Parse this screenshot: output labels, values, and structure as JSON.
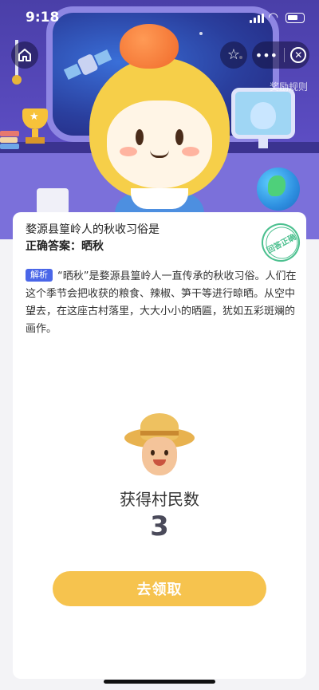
{
  "status_bar": {
    "time": "9:18"
  },
  "header": {
    "rules_link": "奖励规则"
  },
  "card": {
    "question": "婺源县篁岭人的秋收习俗是",
    "answer": "正确答案：晒秋",
    "stamp": "回答正确",
    "analysis_tag": "解析",
    "analysis_text": "“晒秋”是婺源县篁岭人一直传承的秋收习俗。人们在这个季节会把收获的粮食、辣椒、笋干等进行晾晒。从空中望去，在这座古村落里，大大小小的晒匾，犹如五彩斑斓的画作。",
    "reward_label": "获得村民数",
    "reward_count": "3",
    "claim_button": "去领取"
  },
  "icons": {
    "home": "home-icon",
    "favorite": "star-outline-icon",
    "more": "more-dots-icon",
    "close": "close-circle-icon"
  },
  "colors": {
    "hero_bg": "#5b4cc1",
    "tag_bg": "#4a66e8",
    "stamp": "#4cc08f",
    "claim_button": "#f6c34e"
  }
}
